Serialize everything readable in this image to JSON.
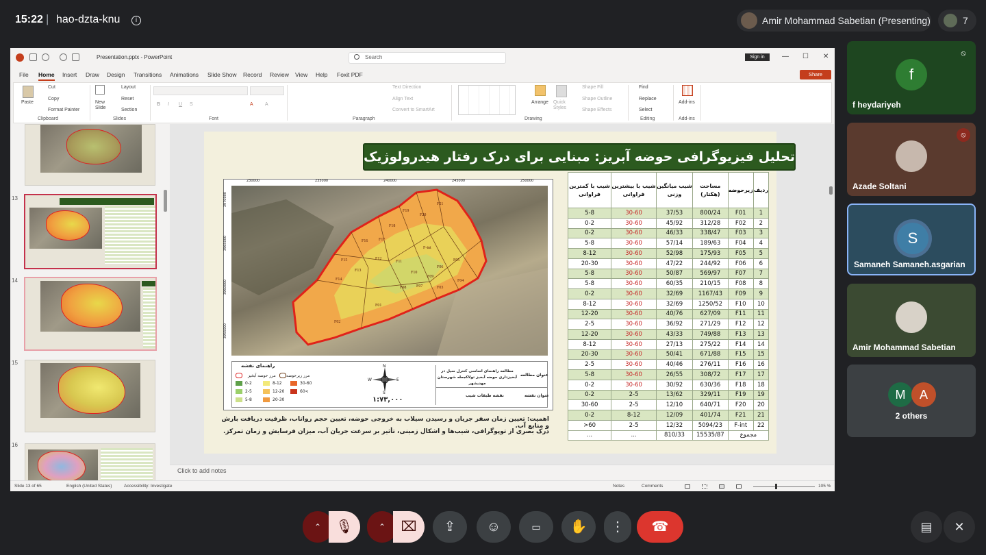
{
  "meet": {
    "time": "15:22",
    "separator": "|",
    "meeting_code": "hao-dzta-knu",
    "info_icon": "i",
    "presenter_label": "Amir Mohammad Sabetian (Presenting)",
    "people_count": "7"
  },
  "ppt": {
    "filename": "Presentation.pptx - PowerPoint",
    "search_placeholder": "Search",
    "sign_in": "Sign in",
    "menu": [
      "File",
      "Home",
      "Insert",
      "Draw",
      "Design",
      "Transitions",
      "Animations",
      "Slide Show",
      "Record",
      "Review",
      "View",
      "Help",
      "Foxit PDF"
    ],
    "share": "Share",
    "ribbon": {
      "paste": "Paste",
      "cut": "Cut",
      "copy": "Copy",
      "format_painter": "Format Painter",
      "new_slide": "New Slide",
      "layout": "Layout",
      "reset": "Reset",
      "section": "Section",
      "text_direction": "Text Direction",
      "align_text": "Align Text",
      "convert_smartart": "Convert to SmartArt",
      "arrange": "Arrange",
      "quick_styles": "Quick Styles",
      "shape_fill": "Shape Fill",
      "shape_outline": "Shape Outline",
      "shape_effects": "Shape Effects",
      "find": "Find",
      "replace": "Replace",
      "select": "Select",
      "add_ins": "Add-ins",
      "groups": {
        "clipboard": "Clipboard",
        "slides": "Slides",
        "font": "Font",
        "paragraph": "Paragraph",
        "drawing": "Drawing",
        "editing": "Editing",
        "add_ins": "Add-ins"
      }
    },
    "thumb_numbers": [
      "13",
      "14",
      "15",
      "16"
    ],
    "notes_placeholder": "Click to add notes",
    "status": {
      "slide_count": "Slide 13 of 65",
      "language": "English (United States)",
      "accessibility": "Accessibility: Investigate",
      "notes": "Notes",
      "comments": "Comments",
      "zoom": "105 %"
    }
  },
  "slide": {
    "title": "تحلیل فیزیوگرافی حوضه آبریز: مبنایی برای درک رفتار هیدرولوژیک",
    "map": {
      "subbasin_labels": [
        "F21",
        "F20",
        "F19",
        "F18",
        "F17",
        "F16",
        "F15",
        "F14",
        "F13",
        "F12",
        "F11",
        "F10",
        "F09",
        "F08",
        "F07",
        "F06",
        "F05",
        "F04",
        "F03",
        "F02",
        "F01",
        "F-int"
      ],
      "legend_title": "راهنمای نقشه",
      "legend_basin": "مرز حوضه آبخیز",
      "legend_subbasin": "مرز زیرحوضه",
      "slope_classes": [
        "0-2",
        "2-5",
        "5-8",
        "8-12",
        "12-20",
        "20-30",
        "30-60",
        ">60"
      ],
      "study_title_label": "عنوان مطالعه",
      "study_title_value": "مطالعه راهنمای اساسی کنترل سیل در آبخیزداری حوضه آبخیز تولاکجعله شهرستان مهدیشهر",
      "map_title_label": "عنوان نقشه",
      "map_title_value": "نقشه طبقات شیب",
      "scale": "۱:۷۳,۰۰۰",
      "compass": [
        "N",
        "S",
        "E",
        "W"
      ],
      "x_ticks": [
        "230000",
        "235000",
        "240000",
        "245000",
        "250000"
      ],
      "y_ticks": [
        "3970000",
        "3965000",
        "3960000",
        "3955000"
      ]
    },
    "description": [
      "اهمیت: تعیین زمان سفر جریان و رسیدن سیلاب به خروجی حوضه، تعیین حجم رواناب، ظرفیت دریافت بارش و منابع آب.",
      "درک بصری از توپوگرافی، شیب‌ها و اشکال زمینی، تأثیر بر سرعت جریان آب، میزان فرسایش و زمان تمرکز."
    ],
    "table": {
      "headers": [
        "ردیف",
        "زیرحوضه",
        "مساحت (هکتار)",
        "شیب میانگین وزنی",
        "شیب با بیشترین فراوانی",
        "شیب با کمترین فراوانی"
      ],
      "rows": [
        [
          "1",
          "F01",
          "800/24",
          "37/53",
          "30-60",
          "5-8"
        ],
        [
          "2",
          "F02",
          "312/28",
          "45/92",
          "30-60",
          "0-2"
        ],
        [
          "3",
          "F03",
          "338/47",
          "46/33",
          "30-60",
          "0-2"
        ],
        [
          "4",
          "F04",
          "189/63",
          "57/14",
          "30-60",
          "5-8"
        ],
        [
          "5",
          "F05",
          "175/93",
          "52/98",
          "30-60",
          "8-12"
        ],
        [
          "6",
          "F06",
          "244/92",
          "47/22",
          "30-60",
          "20-30"
        ],
        [
          "7",
          "F07",
          "569/97",
          "50/87",
          "30-60",
          "5-8"
        ],
        [
          "8",
          "F08",
          "210/15",
          "60/35",
          "30-60",
          "5-8"
        ],
        [
          "9",
          "F09",
          "1167/43",
          "32/69",
          "30-60",
          "0-2"
        ],
        [
          "10",
          "F10",
          "1250/52",
          "32/69",
          "30-60",
          "8-12"
        ],
        [
          "11",
          "F11",
          "627/09",
          "40/76",
          "30-60",
          "12-20"
        ],
        [
          "12",
          "F12",
          "271/29",
          "36/92",
          "30-60",
          "2-5"
        ],
        [
          "13",
          "F13",
          "749/88",
          "43/33",
          "30-60",
          "12-20"
        ],
        [
          "14",
          "F14",
          "275/22",
          "27/13",
          "30-60",
          "8-12"
        ],
        [
          "15",
          "F15",
          "671/88",
          "50/41",
          "30-60",
          "20-30"
        ],
        [
          "16",
          "F16",
          "276/11",
          "40/46",
          "30-60",
          "2-5"
        ],
        [
          "17",
          "F17",
          "308/72",
          "26/55",
          "30-60",
          "5-8"
        ],
        [
          "18",
          "F18",
          "630/36",
          "30/92",
          "30-60",
          "0-2"
        ],
        [
          "19",
          "F19",
          "329/11",
          "13/62",
          "2-5",
          "0-2"
        ],
        [
          "20",
          "F20",
          "640/71",
          "12/10",
          "2-5",
          "30-60"
        ],
        [
          "21",
          "F21",
          "401/74",
          "12/09",
          "8-12",
          "0-2"
        ],
        [
          "22",
          "F-int",
          "5094/23",
          "12/32",
          "2-5",
          ">60"
        ]
      ],
      "total_label": "مجموع",
      "total_area": "15535/87",
      "total_slope": "810/33",
      "total_max": "...",
      "total_min": "..."
    }
  },
  "participants": [
    {
      "name": "f heydariyeh",
      "initial": "f",
      "bg": "#1e4620",
      "avatar_bg": "#2e7d32",
      "muted": true
    },
    {
      "name": "Azade Soltani",
      "initial": "",
      "bg": "#5a3a2e",
      "avatar_bg": "#c7b8ad",
      "muted": true
    },
    {
      "name": "Samaneh Samaneh.asgarian",
      "initial": "S",
      "bg": "#2c4c5e",
      "avatar_bg": "#3f7ea6",
      "muted": false
    },
    {
      "name": "Amir Mohammad Sabetian",
      "initial": "",
      "bg": "#3b4a32",
      "avatar_bg": "#d8d2c8",
      "muted": false
    },
    {
      "name": "2 others",
      "initials": [
        "M",
        "A"
      ],
      "bg": "#3c4043"
    }
  ],
  "colors": {
    "accent_red": "#dc362e",
    "slide_title_green": "#2c5a1f",
    "table_row_green": "#d9e6c2",
    "selected_tile_border": "#8ab4f8"
  }
}
